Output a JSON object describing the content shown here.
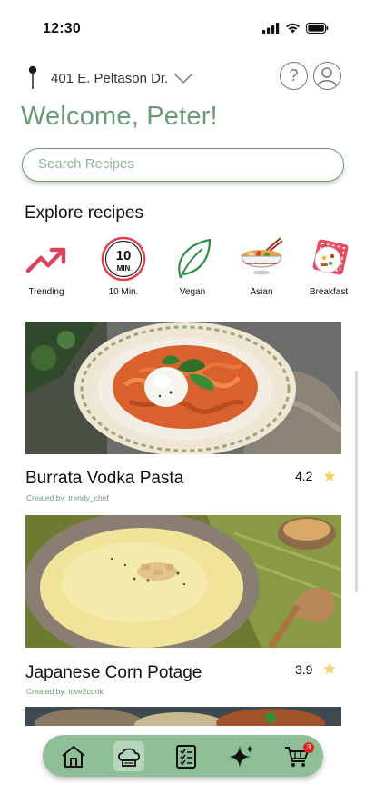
{
  "status_bar": {
    "time": "12:30"
  },
  "location": {
    "address": "401 E. Peltason Dr."
  },
  "header": {
    "help_label": "?"
  },
  "welcome": {
    "title": "Welcome, Peter!"
  },
  "search": {
    "placeholder": "Search Recipes"
  },
  "explore": {
    "title": "Explore recipes",
    "categories": [
      {
        "label": "Trending",
        "icon": "trending-arrow-icon"
      },
      {
        "label": "10 Min.",
        "icon": "ten-minute-timer-icon",
        "icon_text_top": "10",
        "icon_text_bottom": "MIN"
      },
      {
        "label": "Vegan",
        "icon": "leaf-icon"
      },
      {
        "label": "Asian",
        "icon": "noodle-bowl-icon"
      },
      {
        "label": "Breakfast",
        "icon": "breakfast-plate-icon"
      }
    ]
  },
  "recipes": [
    {
      "title": "Burrata Vodka Pasta",
      "author": "Created by: trendy_chef",
      "rating": "4.2"
    },
    {
      "title": "Japanese Corn Potage",
      "author": "Created by: love2cook",
      "rating": "3.9"
    }
  ],
  "nav": {
    "items": [
      "home-icon",
      "chef-hat-icon",
      "checklist-icon",
      "sparkle-icon",
      "cart-icon"
    ],
    "active": "chef-hat-icon",
    "cart_count": "3"
  },
  "colors": {
    "accent": "#6a9b74",
    "nav_bg": "#8fbf97",
    "star": "#f2d36b",
    "badge": "#e32222"
  }
}
